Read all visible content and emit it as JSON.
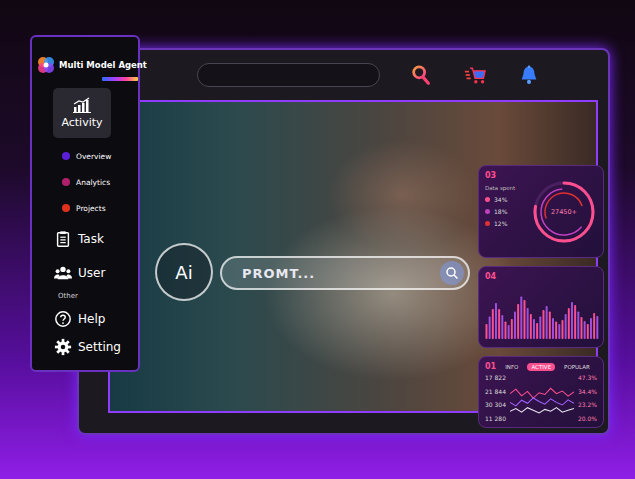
{
  "logo": {
    "title": "Multi Model Agent"
  },
  "sidebar": {
    "items": [
      {
        "label": "Activity",
        "kind": "activity",
        "selected": true
      },
      {
        "label": "Overview",
        "kind": "sub",
        "selected": false,
        "color": "#5a1fd6"
      },
      {
        "label": "Analytics",
        "kind": "sub",
        "selected": false,
        "color": "#b0206a"
      },
      {
        "label": "Projects",
        "kind": "sub",
        "selected": false,
        "color": "#e0301e"
      },
      {
        "label": "Task",
        "kind": "main",
        "selected": false
      },
      {
        "label": "User",
        "kind": "main",
        "selected": false
      },
      {
        "label": "Other",
        "kind": "section",
        "selected": false
      },
      {
        "label": "Help",
        "kind": "main",
        "selected": false
      },
      {
        "label": "Setting",
        "kind": "main",
        "selected": false
      }
    ]
  },
  "prompt": {
    "ai_label": "Ai",
    "placeholder": "PROMT..."
  },
  "card03": {
    "number": "03",
    "subtitle": "Data spent",
    "legend": [
      {
        "label": "34%",
        "color": "#ff4f8f"
      },
      {
        "label": "18%",
        "color": "#c040c0"
      },
      {
        "label": "12%",
        "color": "#e03030"
      }
    ],
    "ring": {
      "value": "27450+",
      "level": 0.78
    }
  },
  "card04": {
    "number": "04",
    "series": [
      30,
      45,
      60,
      72,
      60,
      48,
      35,
      28,
      40,
      55,
      70,
      85,
      78,
      62,
      50,
      40,
      32,
      45,
      58,
      66,
      55,
      42,
      35,
      30,
      38,
      50,
      62,
      74,
      68,
      55,
      44,
      36,
      30,
      42,
      52,
      46
    ]
  },
  "card01": {
    "number": "01",
    "tabs": [
      {
        "label": "INFO",
        "selected": false
      },
      {
        "label": "ACTIVE",
        "selected": true
      },
      {
        "label": "POPULAR",
        "selected": false
      }
    ],
    "rows": [
      {
        "value": "17 822",
        "pct": "47.3%"
      },
      {
        "value": "21 844",
        "pct": "34.4%"
      },
      {
        "value": "30 304",
        "pct": "23.2%"
      },
      {
        "value": "11 280",
        "pct": "20.0%"
      }
    ],
    "lines": [
      {
        "color": "#ff4f8f",
        "values": [
          60,
          70,
          55,
          65,
          50,
          62,
          58,
          72,
          60,
          66,
          54,
          64
        ]
      },
      {
        "color": "#a060ff",
        "values": [
          40,
          32,
          45,
          38,
          50,
          42,
          36,
          48,
          40,
          34,
          46,
          38
        ]
      },
      {
        "color": "#e8e8f0",
        "values": [
          20,
          26,
          18,
          28,
          22,
          16,
          24,
          20,
          28,
          18,
          22,
          26
        ]
      }
    ]
  }
}
